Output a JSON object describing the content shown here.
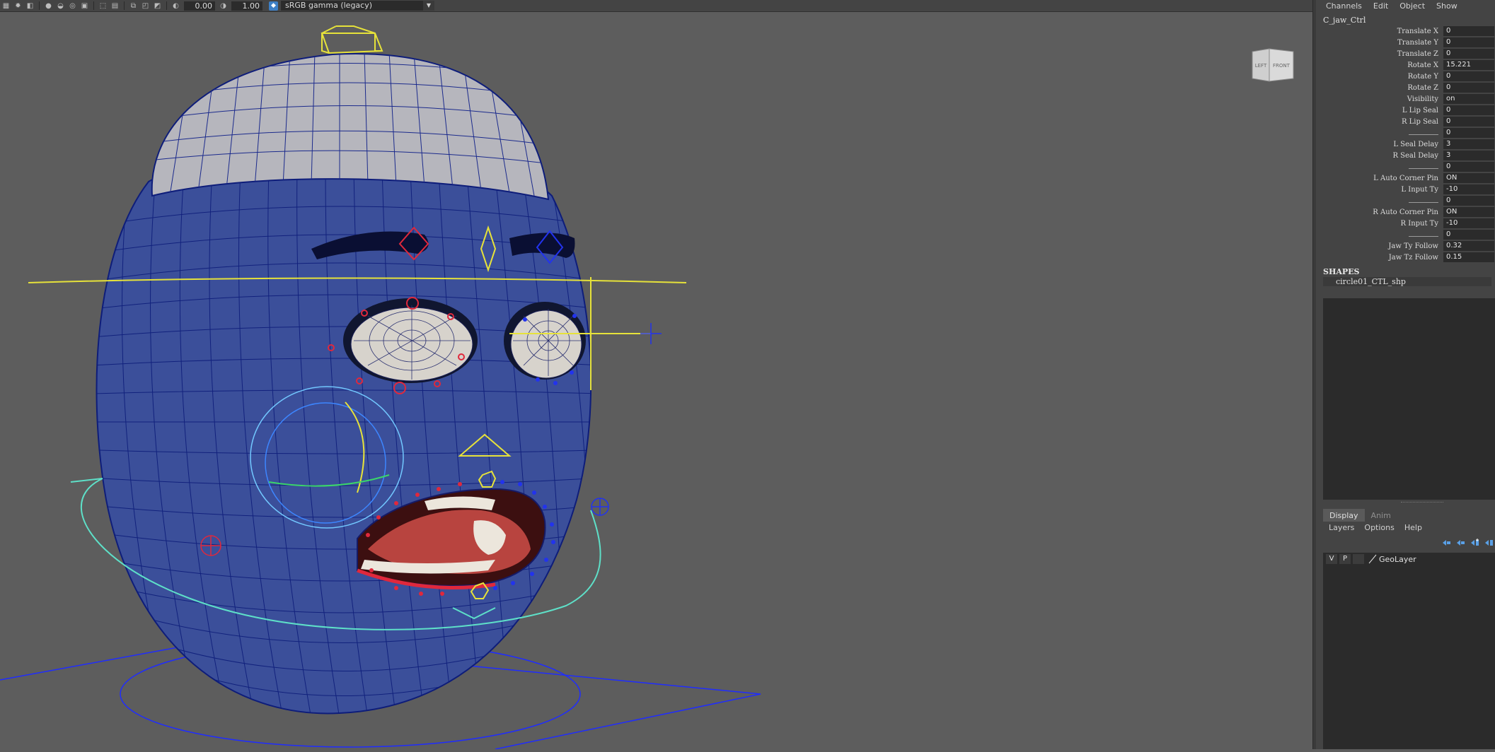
{
  "toolbar": {
    "exposure": "0.00",
    "gamma": "1.00",
    "color_space": "sRGB gamma (legacy)"
  },
  "viewcube": {
    "left_face": "LEFT",
    "front_face": "FRONT"
  },
  "channel_box": {
    "menu": [
      "Channels",
      "Edit",
      "Object",
      "Show"
    ],
    "node_name": "C_jaw_Ctrl",
    "attributes": [
      {
        "label": "Translate X",
        "value": "0"
      },
      {
        "label": "Translate Y",
        "value": "0"
      },
      {
        "label": "Translate Z",
        "value": "0"
      },
      {
        "label": "Rotate X",
        "value": "15.221"
      },
      {
        "label": "Rotate Y",
        "value": "0"
      },
      {
        "label": "Rotate Z",
        "value": "0"
      },
      {
        "label": "Visibility",
        "value": "on"
      },
      {
        "label": "L Lip Seal",
        "value": "0"
      },
      {
        "label": "R Lip Seal",
        "value": "0"
      },
      {
        "label": "",
        "value": "0",
        "separator": true
      },
      {
        "label": "L Seal Delay",
        "value": "3"
      },
      {
        "label": "R Seal Delay",
        "value": "3"
      },
      {
        "label": "",
        "value": "0",
        "separator": true
      },
      {
        "label": "L Auto Corner Pin",
        "value": "ON"
      },
      {
        "label": "L Input Ty",
        "value": "-10"
      },
      {
        "label": "",
        "value": "0",
        "separator": true
      },
      {
        "label": "R Auto Corner Pin",
        "value": "ON"
      },
      {
        "label": "R Input Ty",
        "value": "-10"
      },
      {
        "label": "",
        "value": "0",
        "separator": true
      },
      {
        "label": "Jaw Ty Follow",
        "value": "0.32"
      },
      {
        "label": "Jaw Tz Follow",
        "value": "0.15"
      }
    ],
    "shapes_header": "SHAPES",
    "shape_name": "circle01_CTL_shp"
  },
  "layer_editor": {
    "tabs": [
      "Display",
      "Anim"
    ],
    "menu": [
      "Layers",
      "Options",
      "Help"
    ],
    "layer": {
      "v": "V",
      "p": "P",
      "name": "GeoLayer"
    }
  },
  "colors": {
    "viewport_bg": "#5d5d5d",
    "mesh_fill": "#3b4f9a",
    "mesh_wire": "#0e1d7a",
    "beanie": "#b6b6bd",
    "mouth": "#b8443f",
    "ctrl_yellow": "#e6e23a",
    "ctrl_red": "#e0283c",
    "ctrl_blue": "#2233ee",
    "ctrl_cyan": "#5ee0c8"
  },
  "icons": [
    "grid-icon",
    "camera-icon",
    "shading-icon",
    "isolate-icon",
    "exposure-icon",
    "gamma-icon",
    "color-management-icon"
  ]
}
